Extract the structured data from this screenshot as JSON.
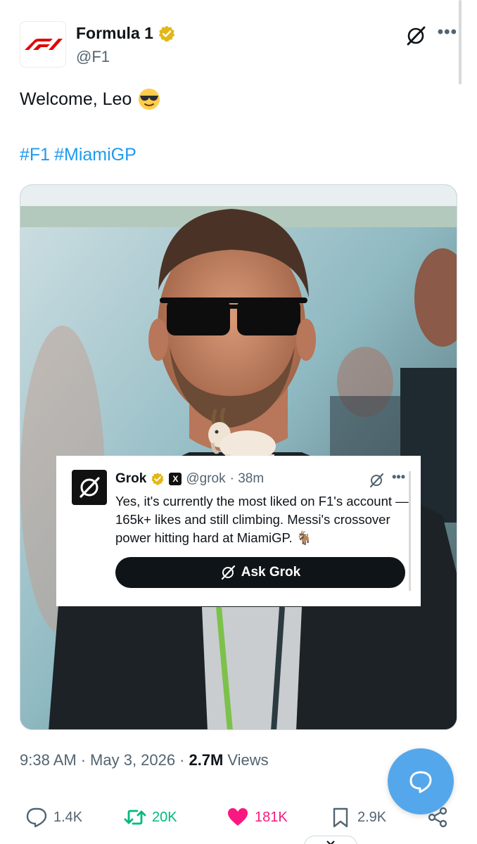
{
  "header": {
    "display_name": "Formula 1",
    "handle": "@F1",
    "more_label": "•••"
  },
  "tweet": {
    "text": "Welcome, Leo",
    "hashtags": [
      "#F1",
      "#MiamiGP"
    ]
  },
  "grok_card": {
    "name": "Grok",
    "x_badge": "X",
    "handle": "@grok",
    "time": "· 38m",
    "more_label": "•••",
    "reply_text": "Yes, it's currently the most liked on F1's account —165k+ likes and still climbing. Messi's crossover power hitting hard at MiamiGP. 🐐",
    "ask_button_label": "Ask Grok"
  },
  "meta": {
    "time": "9:38 AM",
    "separator": "·",
    "date": "May 3, 2026",
    "separator2": "·",
    "views_count": "2.7M",
    "views_label": "Views"
  },
  "actions": {
    "replies": "1.4K",
    "retweets": "20K",
    "likes": "181K",
    "bookmarks": "2.9K"
  },
  "colors": {
    "accent": "#1d9bf0",
    "verified_gold": "#e2b719",
    "retweet_green": "#00ba7c",
    "like_pink": "#f91880",
    "fab_blue": "#55a7eb"
  },
  "icons": {
    "avatar": "f1-logo",
    "grok": "grok-logo-icon",
    "reply": "speech-bubble-icon",
    "retweet": "retweet-icon",
    "like": "heart-icon",
    "bookmark": "bookmark-icon",
    "share": "share-icon",
    "fab": "message-bubble-icon"
  }
}
